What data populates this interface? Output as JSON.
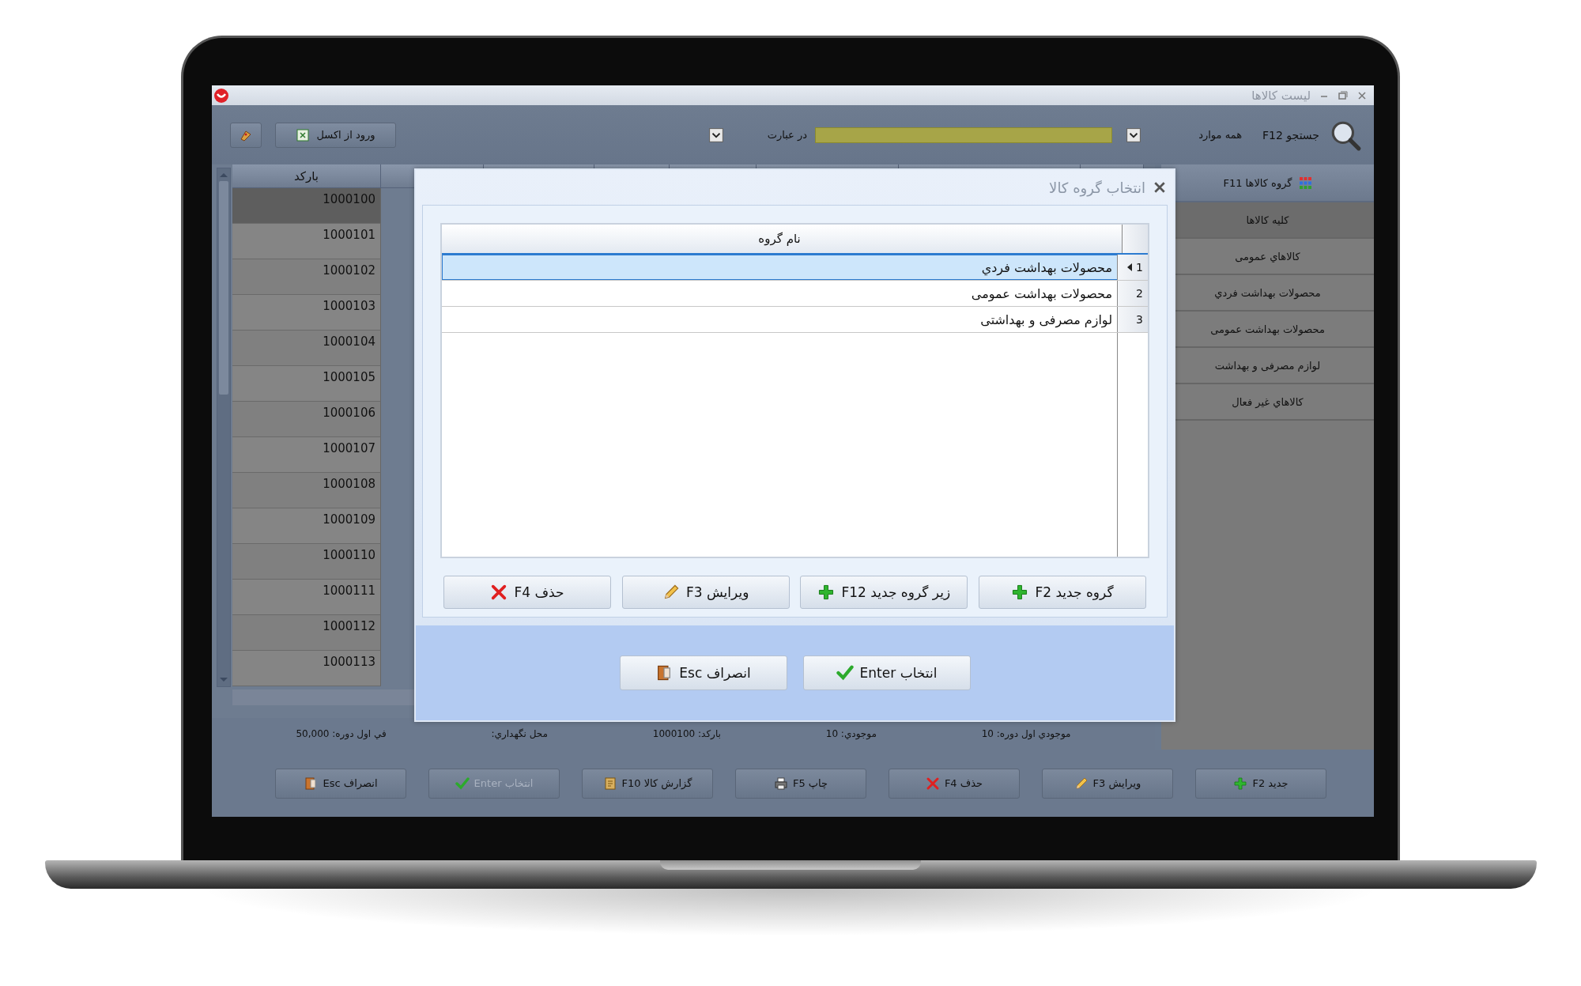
{
  "window": {
    "title": "لیست کالاها"
  },
  "toolbar": {
    "import_button": "ورود از اکسل",
    "match_mode": "در عبارت",
    "scope": "همه موارد",
    "search_label": "جستجو F12"
  },
  "grid": {
    "columns": [
      "بارکد"
    ],
    "rows": [
      {
        "barcode": "1000100",
        "selected": true
      },
      {
        "barcode": "1000101",
        "selected": false
      },
      {
        "barcode": "1000102",
        "selected": false
      },
      {
        "barcode": "1000103",
        "selected": false
      },
      {
        "barcode": "1000104",
        "selected": false
      },
      {
        "barcode": "1000105",
        "selected": false
      },
      {
        "barcode": "1000106",
        "selected": false
      },
      {
        "barcode": "1000107",
        "selected": false
      },
      {
        "barcode": "1000108",
        "selected": false
      },
      {
        "barcode": "1000109",
        "selected": false
      },
      {
        "barcode": "1000110",
        "selected": false
      },
      {
        "barcode": "1000111",
        "selected": false
      },
      {
        "barcode": "1000112",
        "selected": false
      },
      {
        "barcode": "1000113",
        "selected": false
      }
    ]
  },
  "status": [
    "موجودي اول دوره: 10",
    "موجودي: 10",
    "بارکد: 1000100",
    "محل نگهداري:",
    "في اول دوره: 50,000"
  ],
  "sidebar": {
    "title": "گروه کالاها F11",
    "items": [
      {
        "label": "کلیه کالاها",
        "selected": true
      },
      {
        "label": "کالاهاي عمومی",
        "selected": false
      },
      {
        "label": "محصولات بهداشت فردي",
        "selected": false
      },
      {
        "label": "محصولات بهداشت عمومی",
        "selected": false
      },
      {
        "label": "لوازم مصرفی و بهداشت",
        "selected": false
      },
      {
        "label": "کالاهاي غیر فعال",
        "selected": false
      }
    ]
  },
  "footer_buttons": [
    {
      "label": "جدید F2",
      "kind": "add",
      "disabled": false
    },
    {
      "label": "ویرایش F3",
      "kind": "edit",
      "disabled": false
    },
    {
      "label": "حذف F4",
      "kind": "delete",
      "disabled": false
    },
    {
      "label": "چاپ F5",
      "kind": "print",
      "disabled": false
    },
    {
      "label": "گزارش کالا F10",
      "kind": "report",
      "disabled": false
    },
    {
      "label": "انتخاب Enter",
      "kind": "select",
      "disabled": true
    },
    {
      "label": "انصراف Esc",
      "kind": "cancel",
      "disabled": false
    }
  ],
  "dialog": {
    "title": "انتخاب گروه کالا",
    "column": "نام گروه",
    "rows": [
      {
        "index": "1",
        "name": "محصولات بهداشت فردي",
        "selected": true
      },
      {
        "index": "2",
        "name": "محصولات بهداشت عمومی",
        "selected": false
      },
      {
        "index": "3",
        "name": "لوازم مصرفی و بهداشتی",
        "selected": false
      }
    ],
    "buttons": [
      {
        "label": "گروه جدید F2",
        "kind": "add"
      },
      {
        "label": "زیر گروه جدید F12",
        "kind": "add"
      },
      {
        "label": "ویرایش F3",
        "kind": "edit"
      },
      {
        "label": "حذف F4",
        "kind": "delete"
      }
    ],
    "actions": [
      {
        "label": "انتخاب Enter",
        "kind": "select"
      },
      {
        "label": "انصراف Esc",
        "kind": "cancel"
      }
    ]
  }
}
